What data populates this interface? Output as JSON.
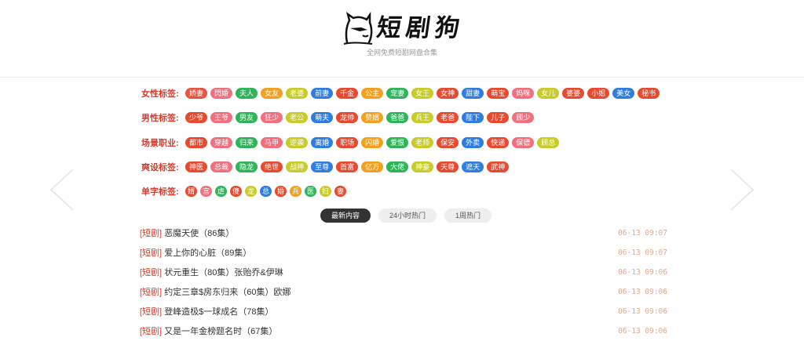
{
  "site": {
    "logo_text": "短剧狗",
    "tagline": "全网免费短剧网盘合集"
  },
  "tag_rows": [
    {
      "label": "女性标签:",
      "tags": [
        {
          "text": "娇妻",
          "color": "#e8543e"
        },
        {
          "text": "閃婚",
          "color": "#f0707e"
        },
        {
          "text": "夫人",
          "color": "#2fb45a"
        },
        {
          "text": "女友",
          "color": "#f2a020"
        },
        {
          "text": "老婆",
          "color": "#c8cc2a"
        },
        {
          "text": "前妻",
          "color": "#2f7de0"
        },
        {
          "text": "千金",
          "color": "#e84a30"
        },
        {
          "text": "公主",
          "color": "#f2a020"
        },
        {
          "text": "宠妻",
          "color": "#2fb45a"
        },
        {
          "text": "女王",
          "color": "#c8cc2a"
        },
        {
          "text": "女神",
          "color": "#e84a30"
        },
        {
          "text": "甜妻",
          "color": "#2f7de0"
        },
        {
          "text": "萌宝",
          "color": "#e84a30"
        },
        {
          "text": "妈咪",
          "color": "#f0707e"
        },
        {
          "text": "女儿",
          "color": "#c8cc2a"
        },
        {
          "text": "婆婆",
          "color": "#e84a30"
        },
        {
          "text": "小姐",
          "color": "#e84a30"
        },
        {
          "text": "美女",
          "color": "#2f7de0"
        },
        {
          "text": "秘书",
          "color": "#e84a30"
        }
      ]
    },
    {
      "label": "男性标签:",
      "tags": [
        {
          "text": "少爷",
          "color": "#e84a30"
        },
        {
          "text": "王爷",
          "color": "#f0707e"
        },
        {
          "text": "男友",
          "color": "#2fb45a"
        },
        {
          "text": "狂少",
          "color": "#f0707e"
        },
        {
          "text": "老公",
          "color": "#c8cc2a"
        },
        {
          "text": "萌夫",
          "color": "#2f7de0"
        },
        {
          "text": "龙帅",
          "color": "#e84a30"
        },
        {
          "text": "赘婿",
          "color": "#f2a020"
        },
        {
          "text": "爸爸",
          "color": "#2fb45a"
        },
        {
          "text": "兵王",
          "color": "#c8cc2a"
        },
        {
          "text": "老爸",
          "color": "#e84a30"
        },
        {
          "text": "陛下",
          "color": "#2f7de0"
        },
        {
          "text": "儿子",
          "color": "#e84a30"
        },
        {
          "text": "顾少",
          "color": "#f0707e"
        }
      ]
    },
    {
      "label": "场景职业:",
      "tags": [
        {
          "text": "都市",
          "color": "#e84a30"
        },
        {
          "text": "穿越",
          "color": "#f0707e"
        },
        {
          "text": "归来",
          "color": "#2fb45a"
        },
        {
          "text": "马甲",
          "color": "#f0707e"
        },
        {
          "text": "逆袭",
          "color": "#c8cc2a"
        },
        {
          "text": "离婚",
          "color": "#2f7de0"
        },
        {
          "text": "职场",
          "color": "#e84a30"
        },
        {
          "text": "闪婚",
          "color": "#f2a020"
        },
        {
          "text": "爱恨",
          "color": "#2fb45a"
        },
        {
          "text": "老师",
          "color": "#c8cc2a"
        },
        {
          "text": "保安",
          "color": "#e84a30"
        },
        {
          "text": "外卖",
          "color": "#2f7de0"
        },
        {
          "text": "快递",
          "color": "#e84a30"
        },
        {
          "text": "保镖",
          "color": "#f0707e"
        },
        {
          "text": "顾总",
          "color": "#c8cc2a"
        }
      ]
    },
    {
      "label": "爽设标签:",
      "tags": [
        {
          "text": "神医",
          "color": "#e84a30"
        },
        {
          "text": "总裁",
          "color": "#f0707e"
        },
        {
          "text": "隐龙",
          "color": "#2fb45a"
        },
        {
          "text": "绝世",
          "color": "#e84a30"
        },
        {
          "text": "战神",
          "color": "#c8cc2a"
        },
        {
          "text": "至尊",
          "color": "#2f7de0"
        },
        {
          "text": "首富",
          "color": "#e84a30"
        },
        {
          "text": "亿万",
          "color": "#f2a020"
        },
        {
          "text": "大佬",
          "color": "#2fb45a"
        },
        {
          "text": "神豪",
          "color": "#c8cc2a"
        },
        {
          "text": "天尊",
          "color": "#e84a30"
        },
        {
          "text": "遮天",
          "color": "#2f7de0"
        },
        {
          "text": "武神",
          "color": "#e84a30"
        }
      ]
    },
    {
      "label": "单字标签:",
      "single": true,
      "tags": [
        {
          "text": "婿",
          "color": "#e84a30"
        },
        {
          "text": "宫",
          "color": "#f0707e"
        },
        {
          "text": "虐",
          "color": "#2fb45a"
        },
        {
          "text": "傻",
          "color": "#e84a30"
        },
        {
          "text": "龙",
          "color": "#c8cc2a"
        },
        {
          "text": "总",
          "color": "#2f7de0"
        },
        {
          "text": "婚",
          "color": "#e84a30"
        },
        {
          "text": "兵",
          "color": "#f2a020"
        },
        {
          "text": "医",
          "color": "#2fb45a"
        },
        {
          "text": "妇",
          "color": "#c8cc2a"
        },
        {
          "text": "妻",
          "color": "#e84a30"
        }
      ]
    }
  ],
  "tabs": [
    {
      "label": "最新内容",
      "active": true
    },
    {
      "label": "24小时热门",
      "active": false
    },
    {
      "label": "1周热门",
      "active": false
    }
  ],
  "items": [
    {
      "category": "[短剧]",
      "title": "恶魔天使（86集）",
      "time": "06-13 09:07"
    },
    {
      "category": "[短剧]",
      "title": "爱上你的心脏（89集）",
      "time": "06-13 09:07"
    },
    {
      "category": "[短剧]",
      "title": "状元重生（80集）张贻乔&伊琳",
      "time": "06-13 09:06"
    },
    {
      "category": "[短剧]",
      "title": "约定三章$房东归来（60集）欧娜",
      "time": "06-13 09:06"
    },
    {
      "category": "[短剧]",
      "title": "登峰造极$一球成名（78集）",
      "time": "06-13 09:06"
    },
    {
      "category": "[短剧]",
      "title": "又是一年金榜题名时（67集）",
      "time": "06-13 09:06"
    }
  ]
}
